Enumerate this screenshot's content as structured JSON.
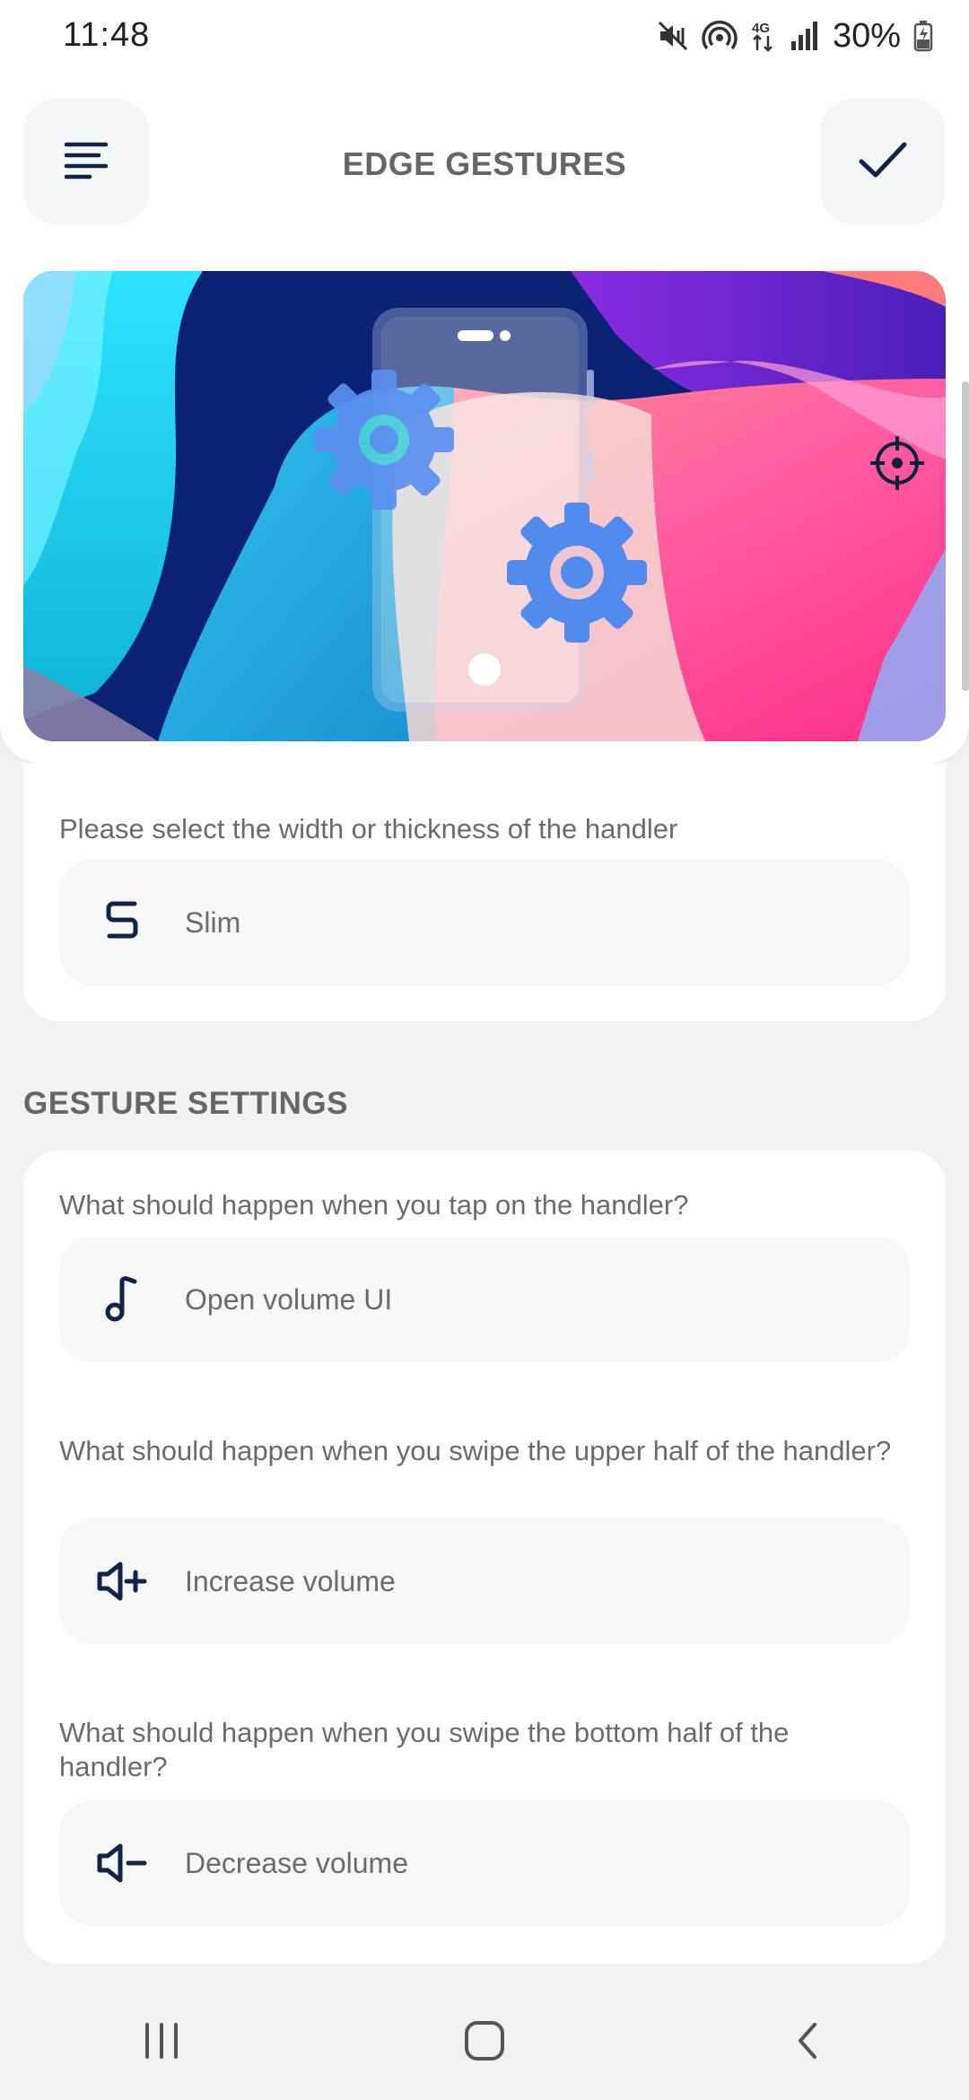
{
  "status_bar": {
    "time": "11:48",
    "battery": "30%",
    "icons": [
      "mute-vibrate-icon",
      "hotspot-icon",
      "4g-data-icon",
      "signal-icon",
      "battery-charging-icon"
    ]
  },
  "app_bar": {
    "title": "EDGE GESTURES",
    "menu_icon": "menu-icon",
    "confirm_icon": "check-icon"
  },
  "colors": {
    "accent": "#0f2447",
    "card": "#ffffff",
    "option_bg": "#f7f7f8",
    "background": "#f2f2f2"
  },
  "handler_width": {
    "question": "Please select the width or thickness of the handler",
    "value": "Slim",
    "icon": "s-letter-icon"
  },
  "gesture_settings": {
    "title": "GESTURE SETTINGS",
    "items": [
      {
        "question": "What should happen when you tap on the handler?",
        "value": "Open volume UI",
        "icon": "music-note-icon"
      },
      {
        "question": "What should happen when you swipe the upper half of the handler?",
        "value": "Increase volume",
        "icon": "volume-up-icon"
      },
      {
        "question": "What should happen when you swipe the bottom half of the handler?",
        "value": "Decrease volume",
        "icon": "volume-down-icon"
      }
    ]
  },
  "nav_bar": {
    "recents_icon": "recents-icon",
    "home_icon": "home-icon",
    "back_icon": "back-icon"
  }
}
